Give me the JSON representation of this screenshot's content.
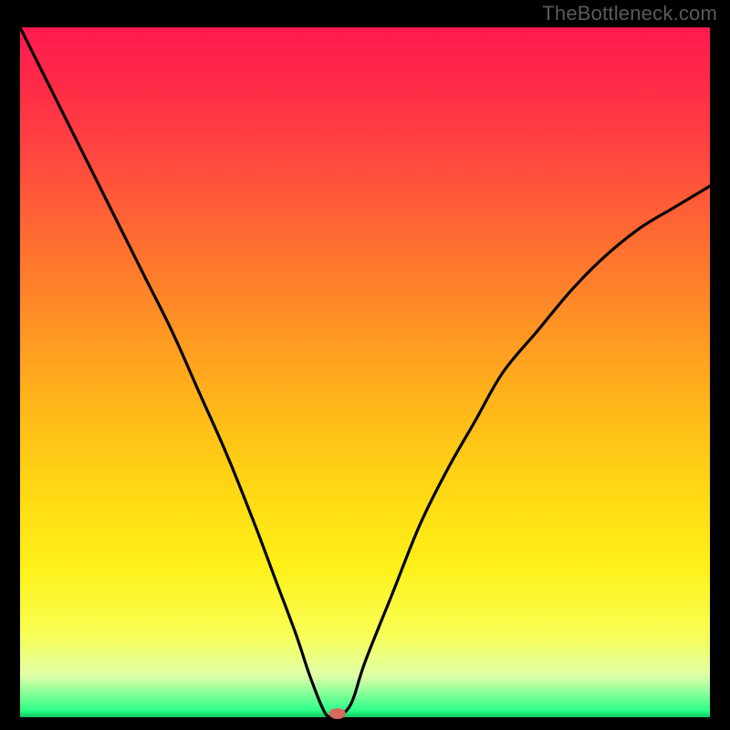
{
  "watermark": "TheBottleneck.com",
  "chart_data": {
    "type": "line",
    "title": "",
    "xlabel": "",
    "ylabel": "",
    "xlim": [
      0,
      100
    ],
    "ylim": [
      0,
      100
    ],
    "series": [
      {
        "name": "bottleneck-curve",
        "x": [
          0,
          3,
          6,
          10,
          14,
          18,
          22,
          26,
          30,
          34,
          37,
          40,
          42,
          44,
          45,
          46,
          48,
          50,
          54,
          58,
          62,
          66,
          70,
          75,
          80,
          85,
          90,
          95,
          100
        ],
        "values": [
          100,
          94,
          88,
          80,
          72,
          64,
          56,
          47,
          38,
          28,
          20,
          12,
          6,
          1,
          0,
          0,
          2,
          8,
          18,
          28,
          36,
          43,
          50,
          56,
          62,
          67,
          71,
          74,
          77
        ]
      }
    ],
    "optimal_marker": {
      "x": 46,
      "y": 0
    },
    "background_gradient": {
      "top": "#ff1a4f",
      "mid": "#ffd513",
      "bottom": "#0cc85d"
    }
  },
  "colors": {
    "curve_stroke": "#000000",
    "frame_background": "#000000",
    "marker_fill": "#d86a60"
  }
}
